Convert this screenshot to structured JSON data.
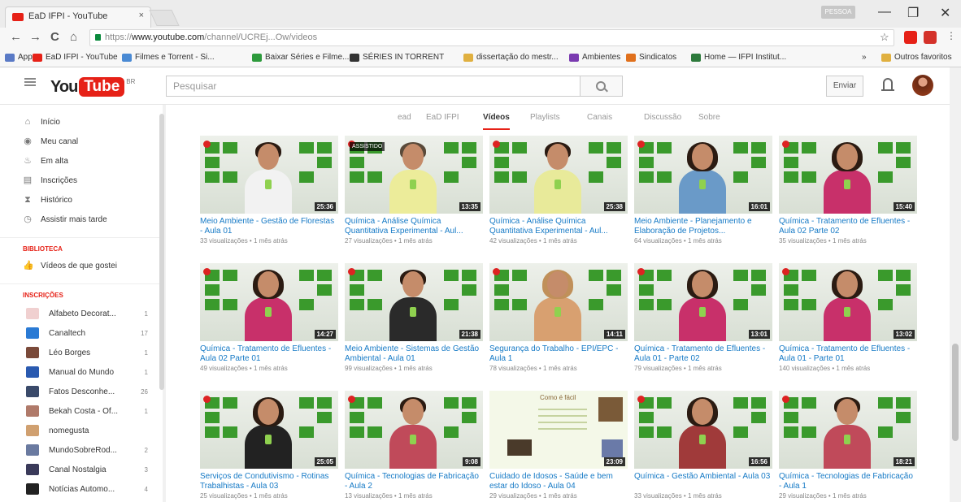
{
  "browser": {
    "tab_title": "EaD IFPI - YouTube",
    "tab_close": "×",
    "profile_badge": "PESSOA",
    "window_controls": {
      "minimize": "—",
      "restore": "❐",
      "close": "✕"
    },
    "nav": {
      "back": "←",
      "forward": "→",
      "reload": "C",
      "home": "⌂"
    },
    "url_scheme": "https://",
    "url_host": "www.youtube.com",
    "url_path": "/channel/UCREj...Ow/videos",
    "star": "☆"
  },
  "bookmarks": [
    {
      "label": "Apps",
      "color": "#5a7ac6"
    },
    {
      "label": "EaD IFPI - YouTube",
      "color": "#e62117"
    },
    {
      "label": "Filmes e Torrent - Si...",
      "color": "#4a8ad4"
    },
    {
      "label": "Baixar Séries e Filme...",
      "color": "#2d9a3c"
    },
    {
      "label": "SÉRIES IN TORRENT",
      "color": "#333333"
    },
    {
      "label": "dissertação do mestr...",
      "color": "#e0b040"
    },
    {
      "label": "Ambientes",
      "color": "#7a3ab0"
    },
    {
      "label": "Sindicatos",
      "color": "#e0701c"
    },
    {
      "label": "Home — IFPI Institut...",
      "color": "#2d7a3c"
    },
    {
      "label": "»",
      "color": ""
    },
    {
      "label": "Outros favoritos",
      "color": "#e0b040"
    }
  ],
  "youtube": {
    "logo_you": "You",
    "logo_tube": "Tube",
    "logo_locale": "BR",
    "search_placeholder": "Pesquisar",
    "upload_label": "Enviar"
  },
  "sidebar": {
    "nav": [
      {
        "icon": "home-icon",
        "glyph": "⌂",
        "label": "Início"
      },
      {
        "icon": "channel-icon",
        "glyph": "◉",
        "label": "Meu canal"
      },
      {
        "icon": "live-icon",
        "glyph": "♨",
        "label": "Em alta"
      },
      {
        "icon": "subscriptions-icon",
        "glyph": "▤",
        "label": "Inscrições"
      },
      {
        "icon": "history-icon",
        "glyph": "⧗",
        "label": "Histórico"
      },
      {
        "icon": "watch-later-icon",
        "glyph": "◷",
        "label": "Assistir mais tarde"
      }
    ],
    "library_title": "BIBLIOTECA",
    "library": [
      {
        "icon": "like-icon",
        "glyph": "👍",
        "label": "Vídeos de que gostei"
      }
    ],
    "subs_title": "INSCRIÇÕES",
    "subscriptions": [
      {
        "name": "Alfabeto Decorat...",
        "count": "1",
        "color": "#f0d0d0"
      },
      {
        "name": "Canaltech",
        "count": "17",
        "color": "#2a7ad4"
      },
      {
        "name": "Léo Borges",
        "count": "1",
        "color": "#7a4a3a"
      },
      {
        "name": "Manual do Mundo",
        "count": "1",
        "color": "#2a5ab0"
      },
      {
        "name": "Fatos Desconhe...",
        "count": "26",
        "color": "#3a4a6a"
      },
      {
        "name": "Bekah Costa - Of...",
        "count": "1",
        "color": "#b07a6a"
      },
      {
        "name": "nomegusta",
        "count": "",
        "color": "#d0a070"
      },
      {
        "name": "MundoSobreRod...",
        "count": "2",
        "color": "#6a7aa0"
      },
      {
        "name": "Canal Nostalgia",
        "count": "3",
        "color": "#3a3a5a"
      },
      {
        "name": "Notícias Automo...",
        "count": "4",
        "color": "#222222"
      }
    ]
  },
  "channel_tabs": [
    "ead",
    "EaD IFPI",
    "Vídeos",
    "Playlists",
    "Canais",
    "Discussão",
    "Sobre"
  ],
  "active_tab": "Vídeos",
  "videos": [
    {
      "title": "Meio Ambiente - Gestão de Florestas - Aula 01",
      "meta": "33 visualizações • 1 mês atrás",
      "duration": "25:36",
      "kind": "man",
      "shirt": "#f2f2f2",
      "hair": "#2b1b12"
    },
    {
      "title": "Química - Análise Química Quantitativa Experimental - Aul...",
      "meta": "27 visualizações • 1 mês atrás",
      "duration": "13:35",
      "kind": "man",
      "shirt": "#ecec9a",
      "hair": "#5a4a3a",
      "badge": "ASSISTIDO"
    },
    {
      "title": "Química - Análise Química Quantitativa Experimental - Aul...",
      "meta": "42 visualizações • 1 mês atrás",
      "duration": "25:38",
      "kind": "man",
      "shirt": "#e8ea9a",
      "hair": "#2b1b12"
    },
    {
      "title": "Meio Ambiente - Planejamento e Elaboração de Projetos...",
      "meta": "64 visualizações • 1 mês atrás",
      "duration": "16:01",
      "kind": "woman",
      "shirt": "#6a9ac8",
      "hair": "#2b1b12"
    },
    {
      "title": "Química - Tratamento de Efluentes - Aula 02 Parte 02",
      "meta": "35 visualizações • 1 mês atrás",
      "duration": "15:40",
      "kind": "woman",
      "shirt": "#c8306a",
      "hair": "#2b1b12"
    },
    {
      "title": "Química - Tratamento de Efluentes - Aula 02 Parte 01",
      "meta": "49 visualizações • 1 mês atrás",
      "duration": "14:27",
      "kind": "woman",
      "shirt": "#c8306a",
      "hair": "#2b1b12"
    },
    {
      "title": "Meio Ambiente - Sistemas de Gestão Ambiental - Aula 01",
      "meta": "99 visualizações • 1 mês atrás",
      "duration": "21:38",
      "kind": "man",
      "shirt": "#2a2a2a",
      "hair": "#2b1b12"
    },
    {
      "title": "Segurança do Trabalho - EPI/EPC - Aula 1",
      "meta": "78 visualizações • 1 mês atrás",
      "duration": "14:11",
      "kind": "woman",
      "shirt": "#d8a070",
      "hair": "#c0905a"
    },
    {
      "title": "Química - Tratamento de Efluentes - Aula 01 - Parte 02",
      "meta": "79 visualizações • 1 mês atrás",
      "duration": "13:01",
      "kind": "woman",
      "shirt": "#c8306a",
      "hair": "#2b1b12"
    },
    {
      "title": "Química - Tratamento de Efluentes - Aula 01 - Parte 01",
      "meta": "140 visualizações • 1 mês atrás",
      "duration": "13:02",
      "kind": "woman",
      "shirt": "#c8306a",
      "hair": "#2b1b12"
    },
    {
      "title": "Serviços de Condutivismo - Rotinas Trabalhistas - Aula 03",
      "meta": "25 visualizações • 1 mês atrás",
      "duration": "25:05",
      "kind": "woman",
      "shirt": "#222222",
      "hair": "#2b1b12"
    },
    {
      "title": "Química - Tecnologias de Fabricação - Aula 2",
      "meta": "13 visualizações • 1 mês atrás",
      "duration": "9:08",
      "kind": "man",
      "shirt": "#c04a5a",
      "hair": "#2b1b12"
    },
    {
      "title": "Cuidado de Idosos - Saúde e bem estar do Idoso - Aula 04",
      "meta": "29 visualizações • 1 mês atrás",
      "duration": "23:09",
      "kind": "slide",
      "slide_title": "Como é fácil"
    },
    {
      "title": "Química - Gestão Ambiental - Aula 03",
      "meta": "33 visualizações • 1 mês atrás",
      "duration": "16:56",
      "kind": "woman",
      "shirt": "#a03a3a",
      "hair": "#2b1b12"
    },
    {
      "title": "Química - Tecnologias de Fabricação - Aula 1",
      "meta": "29 visualizações • 1 mês atrás",
      "duration": "18:21",
      "kind": "man",
      "shirt": "#c04a5a",
      "hair": "#2b1b12"
    }
  ],
  "colors": {
    "brand": "#e62117",
    "link": "#167ac6",
    "ifpi_green": "#3a9a2c"
  }
}
